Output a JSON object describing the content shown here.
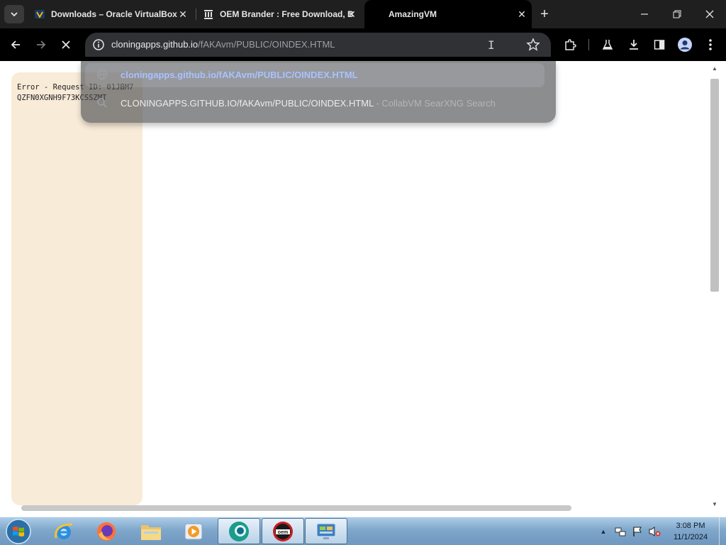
{
  "tabs": [
    {
      "title": "Downloads – Oracle VirtualBox",
      "favicon": "virtualbox-icon"
    },
    {
      "title": "OEM Brander : Free Download, Borrow, and Streaming",
      "favicon": "archive-org-icon"
    },
    {
      "title": "AmazingVM",
      "favicon": "loading",
      "active": true
    }
  ],
  "omnibox": {
    "host": "cloningapps.github.io",
    "path": "/fAKAvm/PUBLIC/OINDEX.HTML"
  },
  "suggestions": [
    {
      "text": "cloningapps.github.io/fAKAvm/PUBLIC/OINDEX.HTML",
      "icon": "globe-icon"
    },
    {
      "text": "CLONINGAPPS.GITHUB.IO/fAKAvm/PUBLIC/OINDEX.HTML",
      "suffix": " - CollabVM SearXNG Search",
      "icon": "search-icon"
    }
  ],
  "page": {
    "error_text": "Error - Request ID: 01JBM7QZFN0XGNH9F73KCSSZMT"
  },
  "taskbar": {
    "time": "3:08 PM",
    "date": "11/1/2024"
  },
  "colors": {
    "tab_strip": "#1f1f1f",
    "toolbar": "#000000",
    "omnibox": "#303134",
    "error_panel": "#f8ebd8",
    "suggestion_link": "#a9c2ff",
    "taskbar": "#8fb3d6"
  }
}
